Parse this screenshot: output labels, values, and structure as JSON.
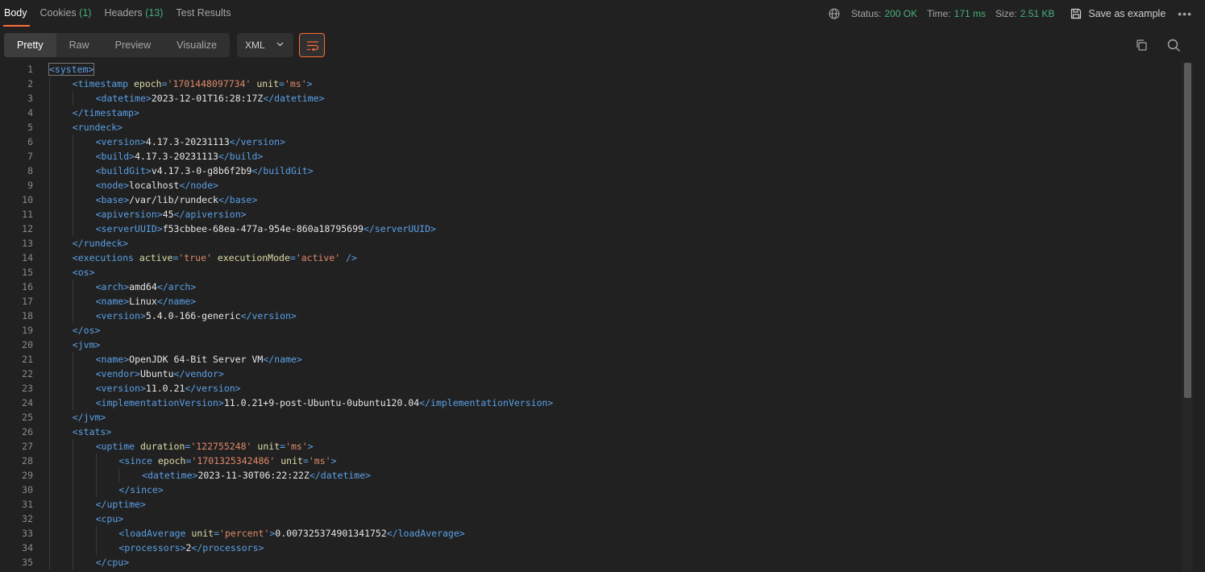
{
  "tabs": [
    {
      "label": "Body",
      "count": ""
    },
    {
      "label": "Cookies",
      "count": "(1)"
    },
    {
      "label": "Headers",
      "count": "(13)"
    },
    {
      "label": "Test Results",
      "count": ""
    }
  ],
  "status": {
    "status_label": "Status:",
    "status_value": "200 OK",
    "time_label": "Time:",
    "time_value": "171 ms",
    "size_label": "Size:",
    "size_value": "2.51 KB",
    "save_label": "Save as example",
    "more": "•••"
  },
  "view_modes": [
    "Pretty",
    "Raw",
    "Preview",
    "Visualize"
  ],
  "format": "XML",
  "colors": {
    "accent": "#ff6c37",
    "ok": "#49b07a",
    "tag": "#5aa0e6",
    "attr": "#dcdcaa",
    "value": "#e0896a"
  },
  "icons": [
    "globe-icon",
    "save-icon",
    "more-icon",
    "chevron-down-icon",
    "wrap-lines-icon",
    "copy-icon",
    "search-icon"
  ],
  "lines": [
    {
      "n": "1",
      "d": 0,
      "t": [
        [
          "tg",
          "<system>"
        ]
      ]
    },
    {
      "n": "2",
      "d": 1,
      "t": [
        [
          "tg",
          "<timestamp "
        ],
        [
          "at",
          "epoch"
        ],
        [
          "tg",
          "="
        ],
        [
          "vl",
          "'1701448097734'"
        ],
        [
          "tg",
          " "
        ],
        [
          "at",
          "unit"
        ],
        [
          "tg",
          "="
        ],
        [
          "vl",
          "'ms'"
        ],
        [
          "tg",
          ">"
        ]
      ]
    },
    {
      "n": "3",
      "d": 2,
      "t": [
        [
          "tg",
          "<datetime>"
        ],
        [
          "tx",
          "2023-12-01T16:28:17Z"
        ],
        [
          "tg",
          "</datetime>"
        ]
      ]
    },
    {
      "n": "4",
      "d": 1,
      "t": [
        [
          "tg",
          "</timestamp>"
        ]
      ]
    },
    {
      "n": "5",
      "d": 1,
      "t": [
        [
          "tg",
          "<rundeck>"
        ]
      ]
    },
    {
      "n": "6",
      "d": 2,
      "t": [
        [
          "tg",
          "<version>"
        ],
        [
          "tx",
          "4.17.3-20231113"
        ],
        [
          "tg",
          "</version>"
        ]
      ]
    },
    {
      "n": "7",
      "d": 2,
      "t": [
        [
          "tg",
          "<build>"
        ],
        [
          "tx",
          "4.17.3-20231113"
        ],
        [
          "tg",
          "</build>"
        ]
      ]
    },
    {
      "n": "8",
      "d": 2,
      "t": [
        [
          "tg",
          "<buildGit>"
        ],
        [
          "tx",
          "v4.17.3-0-g8b6f2b9"
        ],
        [
          "tg",
          "</buildGit>"
        ]
      ]
    },
    {
      "n": "9",
      "d": 2,
      "t": [
        [
          "tg",
          "<node>"
        ],
        [
          "tx",
          "localhost"
        ],
        [
          "tg",
          "</node>"
        ]
      ]
    },
    {
      "n": "10",
      "d": 2,
      "t": [
        [
          "tg",
          "<base>"
        ],
        [
          "tx",
          "/var/lib/rundeck"
        ],
        [
          "tg",
          "</base>"
        ]
      ]
    },
    {
      "n": "11",
      "d": 2,
      "t": [
        [
          "tg",
          "<apiversion>"
        ],
        [
          "tx",
          "45"
        ],
        [
          "tg",
          "</apiversion>"
        ]
      ]
    },
    {
      "n": "12",
      "d": 2,
      "t": [
        [
          "tg",
          "<serverUUID>"
        ],
        [
          "tx",
          "f53cbbee-68ea-477a-954e-860a18795699"
        ],
        [
          "tg",
          "</serverUUID>"
        ]
      ]
    },
    {
      "n": "13",
      "d": 1,
      "t": [
        [
          "tg",
          "</rundeck>"
        ]
      ]
    },
    {
      "n": "14",
      "d": 1,
      "t": [
        [
          "tg",
          "<executions "
        ],
        [
          "at",
          "active"
        ],
        [
          "tg",
          "="
        ],
        [
          "vl",
          "'true'"
        ],
        [
          "tg",
          " "
        ],
        [
          "at",
          "executionMode"
        ],
        [
          "tg",
          "="
        ],
        [
          "vl",
          "'active'"
        ],
        [
          "tg",
          " />"
        ]
      ]
    },
    {
      "n": "15",
      "d": 1,
      "t": [
        [
          "tg",
          "<os>"
        ]
      ]
    },
    {
      "n": "16",
      "d": 2,
      "t": [
        [
          "tg",
          "<arch>"
        ],
        [
          "tx",
          "amd64"
        ],
        [
          "tg",
          "</arch>"
        ]
      ]
    },
    {
      "n": "17",
      "d": 2,
      "t": [
        [
          "tg",
          "<name>"
        ],
        [
          "tx",
          "Linux"
        ],
        [
          "tg",
          "</name>"
        ]
      ]
    },
    {
      "n": "18",
      "d": 2,
      "t": [
        [
          "tg",
          "<version>"
        ],
        [
          "tx",
          "5.4.0-166-generic"
        ],
        [
          "tg",
          "</version>"
        ]
      ]
    },
    {
      "n": "19",
      "d": 1,
      "t": [
        [
          "tg",
          "</os>"
        ]
      ]
    },
    {
      "n": "20",
      "d": 1,
      "t": [
        [
          "tg",
          "<jvm>"
        ]
      ]
    },
    {
      "n": "21",
      "d": 2,
      "t": [
        [
          "tg",
          "<name>"
        ],
        [
          "tx",
          "OpenJDK 64-Bit Server VM"
        ],
        [
          "tg",
          "</name>"
        ]
      ]
    },
    {
      "n": "22",
      "d": 2,
      "t": [
        [
          "tg",
          "<vendor>"
        ],
        [
          "tx",
          "Ubuntu"
        ],
        [
          "tg",
          "</vendor>"
        ]
      ]
    },
    {
      "n": "23",
      "d": 2,
      "t": [
        [
          "tg",
          "<version>"
        ],
        [
          "tx",
          "11.0.21"
        ],
        [
          "tg",
          "</version>"
        ]
      ]
    },
    {
      "n": "24",
      "d": 2,
      "t": [
        [
          "tg",
          "<implementationVersion>"
        ],
        [
          "tx",
          "11.0.21+9-post-Ubuntu-0ubuntu120.04"
        ],
        [
          "tg",
          "</implementationVersion>"
        ]
      ]
    },
    {
      "n": "25",
      "d": 1,
      "t": [
        [
          "tg",
          "</jvm>"
        ]
      ]
    },
    {
      "n": "26",
      "d": 1,
      "t": [
        [
          "tg",
          "<stats>"
        ]
      ]
    },
    {
      "n": "27",
      "d": 2,
      "t": [
        [
          "tg",
          "<uptime "
        ],
        [
          "at",
          "duration"
        ],
        [
          "tg",
          "="
        ],
        [
          "vl",
          "'122755248'"
        ],
        [
          "tg",
          " "
        ],
        [
          "at",
          "unit"
        ],
        [
          "tg",
          "="
        ],
        [
          "vl",
          "'ms'"
        ],
        [
          "tg",
          ">"
        ]
      ]
    },
    {
      "n": "28",
      "d": 3,
      "t": [
        [
          "tg",
          "<since "
        ],
        [
          "at",
          "epoch"
        ],
        [
          "tg",
          "="
        ],
        [
          "vl",
          "'1701325342486'"
        ],
        [
          "tg",
          " "
        ],
        [
          "at",
          "unit"
        ],
        [
          "tg",
          "="
        ],
        [
          "vl",
          "'ms'"
        ],
        [
          "tg",
          ">"
        ]
      ]
    },
    {
      "n": "29",
      "d": 4,
      "t": [
        [
          "tg",
          "<datetime>"
        ],
        [
          "tx",
          "2023-11-30T06:22:22Z"
        ],
        [
          "tg",
          "</datetime>"
        ]
      ]
    },
    {
      "n": "30",
      "d": 3,
      "t": [
        [
          "tg",
          "</since>"
        ]
      ]
    },
    {
      "n": "31",
      "d": 2,
      "t": [
        [
          "tg",
          "</uptime>"
        ]
      ]
    },
    {
      "n": "32",
      "d": 2,
      "t": [
        [
          "tg",
          "<cpu>"
        ]
      ]
    },
    {
      "n": "33",
      "d": 3,
      "t": [
        [
          "tg",
          "<loadAverage "
        ],
        [
          "at",
          "unit"
        ],
        [
          "tg",
          "="
        ],
        [
          "vl",
          "'percent'"
        ],
        [
          "tg",
          ">"
        ],
        [
          "tx",
          "0.007325374901341752"
        ],
        [
          "tg",
          "</loadAverage>"
        ]
      ]
    },
    {
      "n": "34",
      "d": 3,
      "t": [
        [
          "tg",
          "<processors>"
        ],
        [
          "tx",
          "2"
        ],
        [
          "tg",
          "</processors>"
        ]
      ]
    },
    {
      "n": "35",
      "d": 2,
      "t": [
        [
          "tg",
          "</cpu>"
        ]
      ]
    }
  ]
}
